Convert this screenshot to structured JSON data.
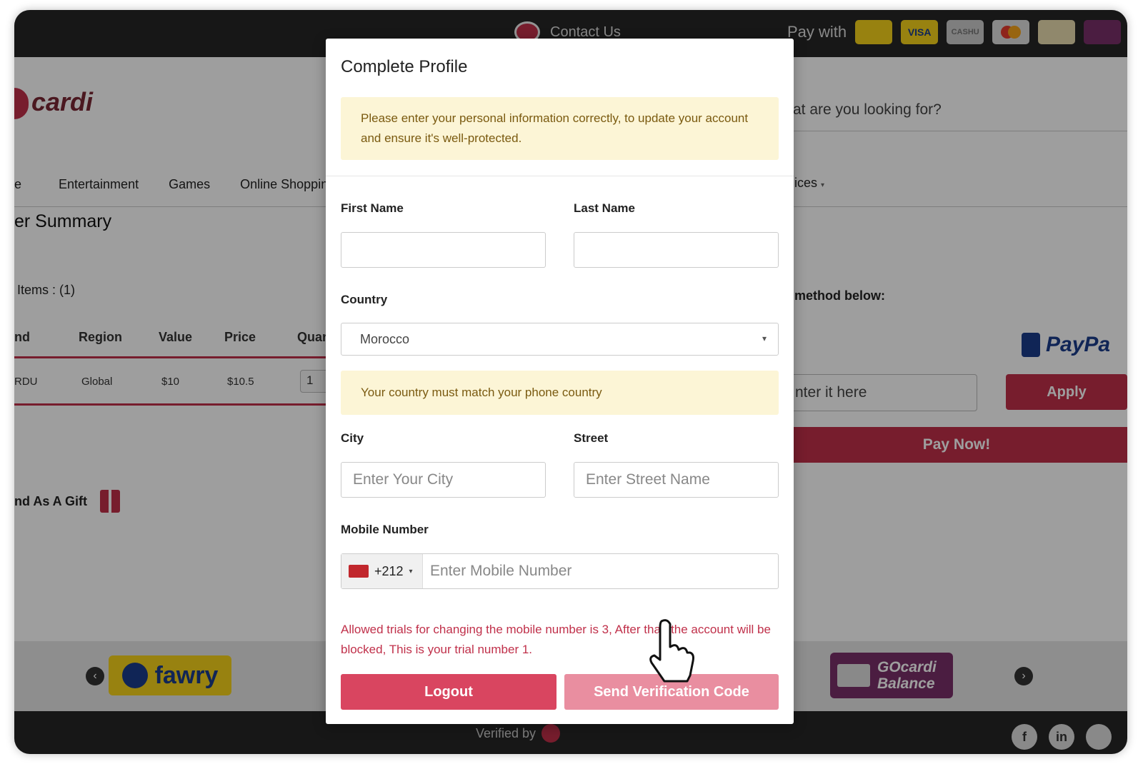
{
  "background": {
    "contact": "Contact Us",
    "pay_with": "Pay with",
    "payment_methods": [
      "fawry",
      "VISA",
      "CASHU",
      "mastercard",
      "other",
      "wallet"
    ],
    "logo": "cardi",
    "nav": [
      "e",
      "Entertainment",
      "Games",
      "Online Shoppin",
      "ices"
    ],
    "summary_title": "er Summary",
    "items_count": "Items : (1)",
    "table": {
      "headers": [
        "nd",
        "Region",
        "Value",
        "Price",
        "Quar"
      ],
      "row": [
        "RDU",
        "Global",
        "$10",
        "$10.5",
        "1"
      ]
    },
    "gift": "nd As A Gift",
    "search_placeholder": "at are you looking for?",
    "pay_method_text": "method below:",
    "paypal": "PayPa",
    "coupon_placeholder": "nter it here",
    "apply": "Apply",
    "pay_now": "Pay Now!",
    "fawry": "fawry",
    "balance": "GOcardi Balance",
    "verified": "Verified by",
    "social": [
      "f",
      "in"
    ]
  },
  "modal": {
    "title": "Complete Profile",
    "info_notice": "Please enter your personal information correctly, to update your account and ensure it's well-protected.",
    "first_name_label": "First Name",
    "last_name_label": "Last Name",
    "country_label": "Country",
    "country_value": "Morocco",
    "country_notice": "Your country must match your phone country",
    "city_label": "City",
    "city_placeholder": "Enter Your City",
    "street_label": "Street",
    "street_placeholder": "Enter Street Name",
    "mobile_label": "Mobile Number",
    "dial_code": "+212",
    "mobile_placeholder": "Enter Mobile Number",
    "trials_warning": "Allowed trials for changing the mobile number is 3, After that, the account will be blocked, This is your trial number 1.",
    "logout": "Logout",
    "send_code": "Send Verification Code"
  }
}
